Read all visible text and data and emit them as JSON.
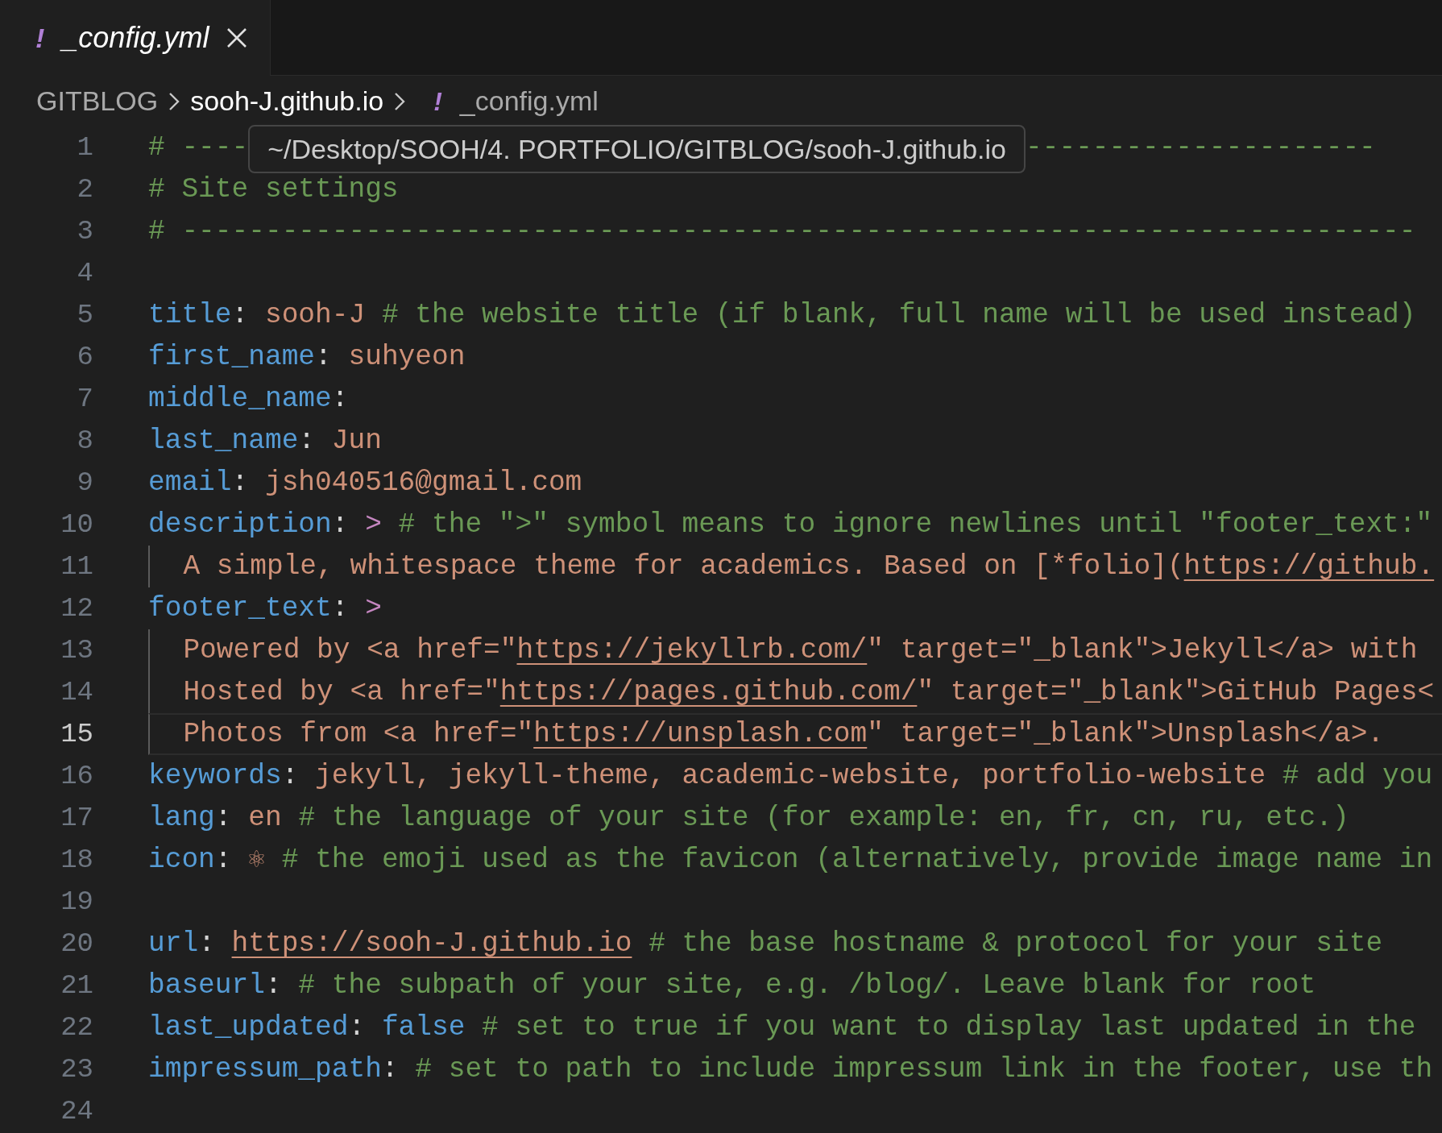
{
  "tabs": [
    {
      "icon": "!",
      "label": "_config.yml",
      "preview": true,
      "selected": true
    }
  ],
  "breadcrumbs": [
    {
      "label": "GITBLOG",
      "selected": false
    },
    {
      "label": "sooh-J.github.io",
      "selected": true
    },
    {
      "icon": "!",
      "label": "_config.yml",
      "selected": false
    }
  ],
  "editor": {
    "lines": [
      {
        "number": "1",
        "current": false,
        "guide": false,
        "tokens": [
          {
            "kind": "comment",
            "text": "# ----"
          },
          {
            "kind": "tooltip",
            "text": "~/Desktop/SOOH/4. PORTFOLIO/GITBLOG/sooh-J.github.io"
          },
          {
            "kind": "comment",
            "text": "---------------------"
          }
        ]
      },
      {
        "number": "2",
        "current": false,
        "guide": false,
        "tokens": [
          {
            "kind": "comment",
            "text": "# Site settings"
          }
        ]
      },
      {
        "number": "3",
        "current": false,
        "guide": false,
        "tokens": [
          {
            "kind": "comment",
            "text": "# --------------------------------------------------------------------------"
          }
        ]
      },
      {
        "number": "4",
        "current": false,
        "guide": false
      },
      {
        "number": "5",
        "current": false,
        "guide": false,
        "tokens": [
          {
            "kind": "key",
            "text": "title"
          },
          {
            "kind": "punct",
            "text": ":"
          },
          {
            "kind": "string",
            "text": " sooh-J"
          },
          {
            "kind": "comment",
            "text": " # the website title (if blank, full name will be used instead)"
          }
        ]
      },
      {
        "number": "6",
        "current": false,
        "guide": false,
        "tokens": [
          {
            "kind": "key",
            "text": "first_name"
          },
          {
            "kind": "punct",
            "text": ":"
          },
          {
            "kind": "string",
            "text": " suhyeon"
          }
        ]
      },
      {
        "number": "7",
        "current": false,
        "guide": false,
        "tokens": [
          {
            "kind": "key",
            "text": "middle_name"
          },
          {
            "kind": "punct",
            "text": ":"
          }
        ]
      },
      {
        "number": "8",
        "current": false,
        "guide": false,
        "tokens": [
          {
            "kind": "key",
            "text": "last_name"
          },
          {
            "kind": "punct",
            "text": ":"
          },
          {
            "kind": "string",
            "text": " Jun"
          }
        ]
      },
      {
        "number": "9",
        "current": false,
        "guide": false,
        "tokens": [
          {
            "kind": "key",
            "text": "email"
          },
          {
            "kind": "punct",
            "text": ":"
          },
          {
            "kind": "string",
            "text": " jsh040516@gmail.com"
          }
        ]
      },
      {
        "number": "10",
        "current": false,
        "guide": false,
        "tokens": [
          {
            "kind": "key",
            "text": "description"
          },
          {
            "kind": "punct",
            "text": ":"
          },
          {
            "kind": "op",
            "text": " >"
          },
          {
            "kind": "comment",
            "text": " # the \">\" symbol means to ignore newlines until \"footer_text:\""
          }
        ]
      },
      {
        "number": "11",
        "current": false,
        "guide": true,
        "tokens": [
          {
            "kind": "string",
            "text": "  A simple, whitespace theme for academics. Based on [*folio]("
          },
          {
            "kind": "link",
            "text": "https://github."
          }
        ]
      },
      {
        "number": "12",
        "current": false,
        "guide": false,
        "tokens": [
          {
            "kind": "key",
            "text": "footer_text"
          },
          {
            "kind": "punct",
            "text": ":"
          },
          {
            "kind": "op",
            "text": " >"
          }
        ]
      },
      {
        "number": "13",
        "current": false,
        "guide": true,
        "tokens": [
          {
            "kind": "string",
            "text": "  Powered by <a href=\""
          },
          {
            "kind": "link",
            "text": "https://jekyllrb.com/"
          },
          {
            "kind": "string",
            "text": "\" target=\"_blank\">Jekyll</a> with"
          }
        ]
      },
      {
        "number": "14",
        "current": false,
        "guide": true,
        "tokens": [
          {
            "kind": "string",
            "text": "  Hosted by <a href=\""
          },
          {
            "kind": "link",
            "text": "https://pages.github.com/"
          },
          {
            "kind": "string",
            "text": "\" target=\"_blank\">GitHub Pages<"
          }
        ]
      },
      {
        "number": "15",
        "current": true,
        "guide": true,
        "tokens": [
          {
            "kind": "string",
            "text": "  Photos from <a href=\""
          },
          {
            "kind": "link",
            "text": "https://unsplash.com"
          },
          {
            "kind": "string",
            "text": "\" target=\"_blank\">Unsplash</a>."
          }
        ]
      },
      {
        "number": "16",
        "current": false,
        "guide": false,
        "tokens": [
          {
            "kind": "key",
            "text": "keywords"
          },
          {
            "kind": "punct",
            "text": ":"
          },
          {
            "kind": "string",
            "text": " jekyll, jekyll-theme, academic-website, portfolio-website"
          },
          {
            "kind": "comment",
            "text": " # add you"
          }
        ]
      },
      {
        "number": "17",
        "current": false,
        "guide": false,
        "tokens": [
          {
            "kind": "key",
            "text": "lang"
          },
          {
            "kind": "punct",
            "text": ":"
          },
          {
            "kind": "string",
            "text": " en"
          },
          {
            "kind": "comment",
            "text": " # the language of your site (for example: en, fr, cn, ru, etc.)"
          }
        ]
      },
      {
        "number": "18",
        "current": false,
        "guide": false,
        "tokens": [
          {
            "kind": "key",
            "text": "icon"
          },
          {
            "kind": "punct",
            "text": ":"
          },
          {
            "kind": "string",
            "text": " ⚛"
          },
          {
            "kind": "comment",
            "text": " # the emoji used as the favicon (alternatively, provide image name in"
          }
        ]
      },
      {
        "number": "19",
        "current": false,
        "guide": false
      },
      {
        "number": "20",
        "current": false,
        "guide": false,
        "tokens": [
          {
            "kind": "key",
            "text": "url"
          },
          {
            "kind": "punct",
            "text": ": "
          },
          {
            "kind": "link",
            "text": "https://sooh-J.github.io"
          },
          {
            "kind": "comment",
            "text": " # the base hostname & protocol for your site"
          }
        ]
      },
      {
        "number": "21",
        "current": false,
        "guide": false,
        "tokens": [
          {
            "kind": "key",
            "text": "baseurl"
          },
          {
            "kind": "punct",
            "text": ":"
          },
          {
            "kind": "comment",
            "text": " # the subpath of your site, e.g. /blog/. Leave blank for root"
          }
        ]
      },
      {
        "number": "22",
        "current": false,
        "guide": false,
        "tokens": [
          {
            "kind": "key",
            "text": "last_updated"
          },
          {
            "kind": "punct",
            "text": ":"
          },
          {
            "kind": "bool",
            "text": " false"
          },
          {
            "kind": "comment",
            "text": " # set to true if you want to display last updated in the"
          }
        ]
      },
      {
        "number": "23",
        "current": false,
        "guide": false,
        "tokens": [
          {
            "kind": "key",
            "text": "impressum_path"
          },
          {
            "kind": "punct",
            "text": ":"
          },
          {
            "kind": "comment",
            "text": " # set to path to include impressum link in the footer, use th"
          }
        ]
      },
      {
        "number": "24",
        "current": false,
        "guide": false
      }
    ]
  }
}
